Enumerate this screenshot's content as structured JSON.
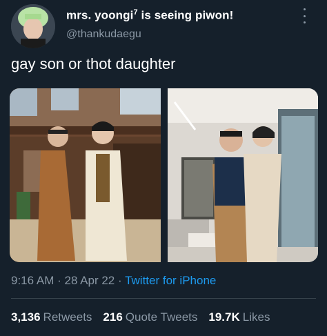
{
  "user": {
    "display_name": "mrs. yoongi",
    "display_name_sup": "7",
    "display_name_rest": " is seeing piwon!",
    "handle": "@thankudaegu",
    "avatar_icon": "avatar-photo"
  },
  "tweet": {
    "text": "gay son or thot daughter"
  },
  "media": {
    "photos": [
      "photo-left",
      "photo-right"
    ]
  },
  "meta": {
    "time": "9:16 AM",
    "separator": " · ",
    "date": "28 Apr 22",
    "separator2": " · ",
    "source": "Twitter for iPhone"
  },
  "stats": {
    "retweets_count": "3,136",
    "retweets_label": "Retweets",
    "quotes_count": "216",
    "quotes_label": "Quote Tweets",
    "likes_count": "19.7K",
    "likes_label": "Likes"
  },
  "colors": {
    "background": "#15202b",
    "secondary_text": "#8b98a5",
    "link": "#1d9bf0",
    "divider": "#38444d"
  }
}
